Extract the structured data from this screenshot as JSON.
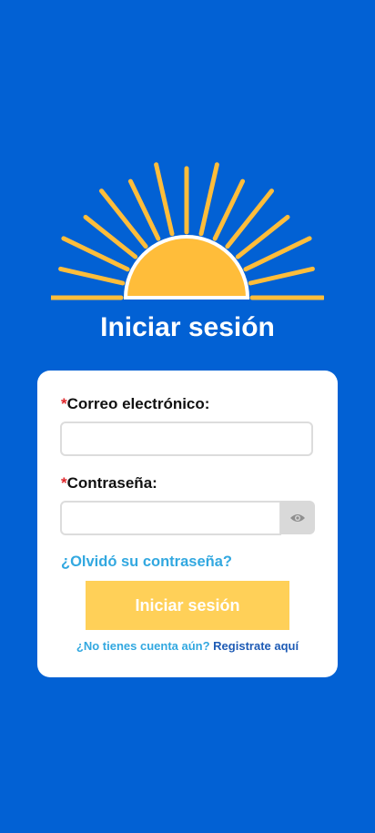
{
  "colors": {
    "background": "#0261d4",
    "sun": "#ffbd3a",
    "rays": "#ffbd3a",
    "card": "#ffffff",
    "required_marker": "#e0262b",
    "link": "#32a8e0",
    "register_link": "#1e5bb5",
    "submit_button": "#ffd058"
  },
  "header": {
    "logo_icon": "sunrise-icon",
    "title": "Iniciar sesión"
  },
  "form": {
    "required_marker": "*",
    "email": {
      "label": "Correo electrónico:",
      "value": "",
      "placeholder": ""
    },
    "password": {
      "label": "Contraseña:",
      "value": "",
      "placeholder": "",
      "toggle_icon": "eye-icon"
    },
    "forgot_password": "¿Olvidó su contraseña?",
    "submit_label": "Iniciar sesión",
    "no_account_text": "¿No tienes cuenta aún?",
    "register_link": "Registrate aquí"
  }
}
